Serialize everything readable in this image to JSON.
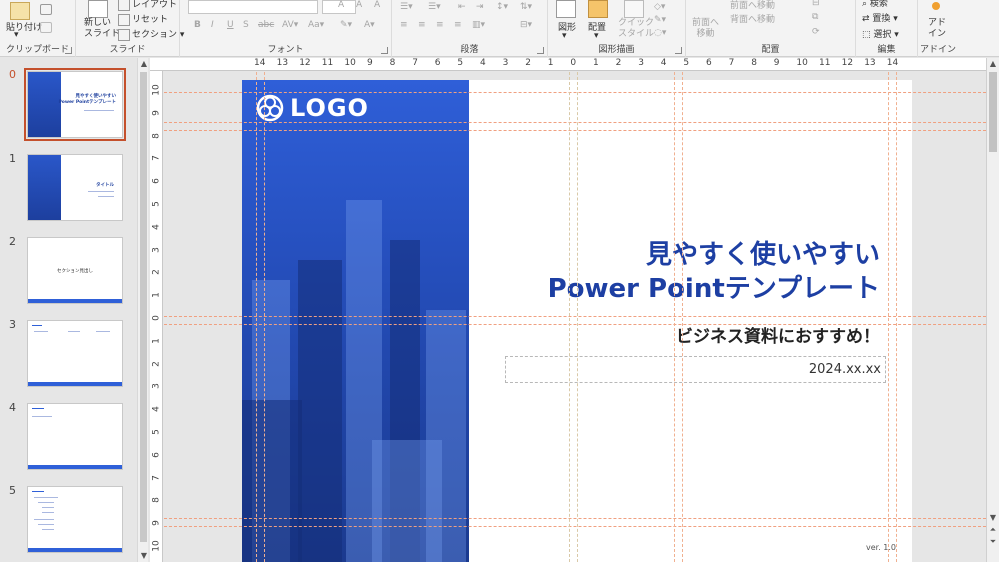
{
  "ribbon": {
    "clipboard": {
      "label": "クリップボード",
      "paste": "貼り付け"
    },
    "slides": {
      "label": "スライド",
      "new_slide": "新しい\nスライド",
      "layout": "レイアウト",
      "reset": "リセット",
      "section": "セクション"
    },
    "font": {
      "label": "フォント"
    },
    "paragraph": {
      "label": "段落"
    },
    "drawing": {
      "label": "図形描画",
      "shapes": "図形",
      "arrange": "配置",
      "quick_styles": "クイック\nスタイル"
    },
    "arrange": {
      "label": "配置",
      "bring_forward": "前面へ移動",
      "send_backward": "背面へ移動",
      "bring_forward2": "前面へ\n移動"
    },
    "editing": {
      "label": "編集",
      "find": "検索",
      "replace": "置換",
      "select": "選択"
    },
    "addins": {
      "label": "アドイン",
      "addins_btn": "アド\nイン"
    }
  },
  "thumbnails": [
    {
      "num": "0",
      "title": "見やすく使いやすい\nPower Pointテンプレート",
      "active": true
    },
    {
      "num": "1",
      "title": "タイトル"
    },
    {
      "num": "2",
      "title": "セクション見出し"
    },
    {
      "num": "3",
      "title": ""
    },
    {
      "num": "4",
      "title": ""
    },
    {
      "num": "5",
      "title": ""
    }
  ],
  "ruler": {
    "h": [
      "14",
      "13",
      "12",
      "11",
      "10",
      "9",
      "8",
      "7",
      "6",
      "5",
      "4",
      "3",
      "2",
      "1",
      "0",
      "1",
      "2",
      "3",
      "4",
      "5",
      "6",
      "7",
      "8",
      "9",
      "10",
      "11",
      "12",
      "13",
      "14"
    ],
    "v": [
      "10",
      "9",
      "8",
      "7",
      "6",
      "5",
      "4",
      "3",
      "2",
      "1",
      "0",
      "1",
      "2",
      "3",
      "4",
      "5",
      "6",
      "7",
      "8",
      "9",
      "10"
    ]
  },
  "slide": {
    "logo": "LOGO",
    "title_line1": "見やすく使いやすい",
    "title_line2": "Power Pointテンプレート",
    "subtitle": "ビジネス資料におすすめ！",
    "date": "2024.xx.xx",
    "version": "ver. 1.0"
  },
  "colors": {
    "accent": "#1d3fa3",
    "selection": "#c4502c",
    "photo_blue": "#2650bf"
  }
}
